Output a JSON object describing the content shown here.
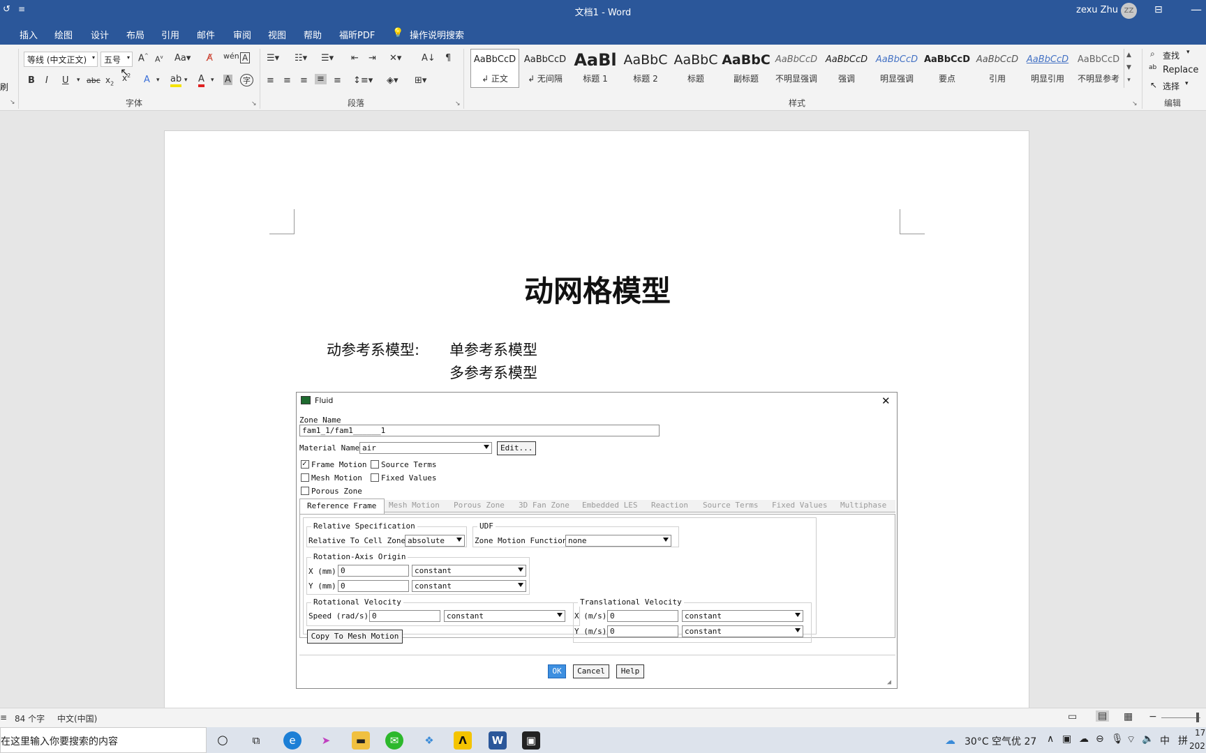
{
  "window": {
    "title": "文档1  -  Word",
    "user": "zexu Zhu",
    "avatar": "ZZ"
  },
  "tabs": [
    "插入",
    "绘图",
    "设计",
    "布局",
    "引用",
    "邮件",
    "审阅",
    "视图",
    "帮助",
    "福昕PDF"
  ],
  "tell_me": "操作说明搜索",
  "ribbon": {
    "clipboard_label": "刷",
    "font_name": "等线 (中文正文)",
    "font_size": "五号",
    "font_group": "字体",
    "para_group": "段落",
    "styles_group": "样式",
    "edit_group": "编辑",
    "find": "查找",
    "replace": "Replace",
    "select": "选择",
    "styles": [
      {
        "sample": "AaBbCcD",
        "name": "↲ 正文"
      },
      {
        "sample": "AaBbCcD",
        "name": "↲ 无间隔"
      },
      {
        "sample": "AaBl",
        "name": "标题 1"
      },
      {
        "sample": "AaBbC",
        "name": "标题 2"
      },
      {
        "sample": "AaBbC",
        "name": "标题"
      },
      {
        "sample": "AaBbC",
        "name": "副标题"
      },
      {
        "sample": "AaBbCcD",
        "name": "不明显强调"
      },
      {
        "sample": "AaBbCcD",
        "name": "强调"
      },
      {
        "sample": "AaBbCcD",
        "name": "明显强调"
      },
      {
        "sample": "AaBbCcD",
        "name": "要点"
      },
      {
        "sample": "AaBbCcD",
        "name": "引用"
      },
      {
        "sample": "AaBbCcD",
        "name": "明显引用"
      },
      {
        "sample": "AaBbCcD",
        "name": "不明显参考"
      }
    ]
  },
  "document": {
    "title": "动网格模型",
    "line1_label": "动参考系模型:",
    "line1_value": "单参考系模型",
    "line2_value": "多参考系模型"
  },
  "dialog": {
    "title": "Fluid",
    "zone_name_label": "Zone Name",
    "zone_name_value": "fam1_1/fam1______1",
    "material_label": "Material Name",
    "material_value": "air",
    "edit_button": "Edit...",
    "checks": {
      "frame_motion": "Frame Motion",
      "source_terms": "Source Terms",
      "mesh_motion": "Mesh Motion",
      "fixed_values": "Fixed Values",
      "porous_zone": "Porous Zone"
    },
    "tabs": [
      "Reference Frame",
      "Mesh Motion",
      "Porous Zone",
      "3D Fan Zone",
      "Embedded LES",
      "Reaction",
      "Source Terms",
      "Fixed Values",
      "Multiphase"
    ],
    "relative_spec": "Relative Specification",
    "relative_label": "Relative To Cell Zone",
    "relative_value": "absolute",
    "udf": "UDF",
    "zone_motion_label": "Zone Motion Function",
    "zone_motion_value": "none",
    "rot_origin": "Rotation-Axis Origin",
    "x_mm": "X (mm)",
    "y_mm": "Y (mm)",
    "zero": "0",
    "constant": "constant",
    "rot_vel": "Rotational Velocity",
    "speed_label": "Speed (rad/s)",
    "trans_vel": "Translational Velocity",
    "x_ms": "X (m/s)",
    "y_ms": "Y (m/s)",
    "copy_btn": "Copy To Mesh Motion",
    "ok": "OK",
    "cancel": "Cancel",
    "help": "Help"
  },
  "status": {
    "words": "84 个字",
    "lang": "中文(中国)"
  },
  "taskbar": {
    "search": "在这里输入你要搜索的内容",
    "weather": "30°C  空气优 27",
    "ime": "中",
    "ime2": "拼",
    "clock_top": "17",
    "clock_bottom": "202"
  }
}
